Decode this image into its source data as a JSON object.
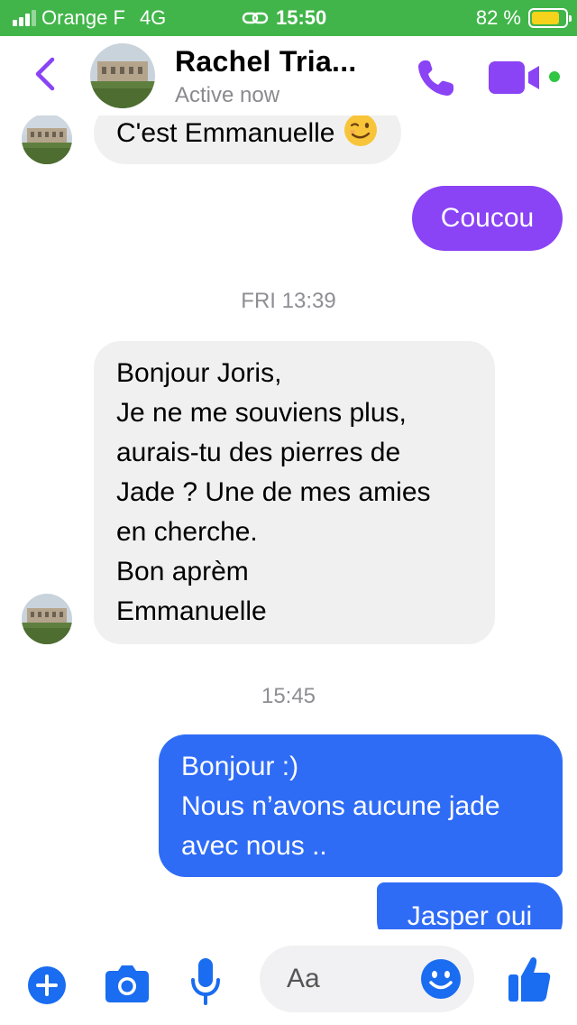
{
  "status_bar": {
    "carrier": "Orange F",
    "network": "4G",
    "time": "15:50",
    "battery_percent_label": "82 %",
    "battery_level": 0.82,
    "signal_bars": 3
  },
  "header": {
    "back_icon": "chevron-left-icon",
    "contact_name": "Rachel Tria...",
    "contact_status": "Active now",
    "call_icon": "phone-icon",
    "video_icon": "video-camera-icon",
    "online": true
  },
  "messages": [
    {
      "from": "them",
      "text": "C'est Emmanuelle",
      "emoji": "winking-face"
    },
    {
      "from": "me",
      "text": "Coucou"
    },
    {
      "type": "timestamp",
      "text": "FRI 13:39"
    },
    {
      "from": "them",
      "lines": [
        "Bonjour Joris,",
        "Je ne me souviens plus,",
        "aurais-tu des pierres de",
        "Jade ? Une de mes amies",
        "en cherche.",
        "Bon aprèm",
        "Emmanuelle"
      ]
    },
    {
      "type": "timestamp",
      "text": "15:45"
    },
    {
      "from": "me",
      "lines": [
        "Bonjour :)",
        "Nous n’avons aucune jade",
        "avec nous .."
      ]
    },
    {
      "from": "me",
      "text": "Jasper oui"
    }
  ],
  "composer": {
    "placeholder": "Aa",
    "icons": [
      "plus-icon",
      "camera-icon",
      "microphone-icon",
      "smiley-icon",
      "thumbs-up-icon"
    ]
  },
  "colors": {
    "status_bar_bg": "#41b549",
    "accent_purple": "#8a43f5",
    "bubble_blue": "#2f6cf6",
    "bubble_incoming": "#f0f0f0",
    "composer_icon_blue": "#1a6cf0"
  }
}
